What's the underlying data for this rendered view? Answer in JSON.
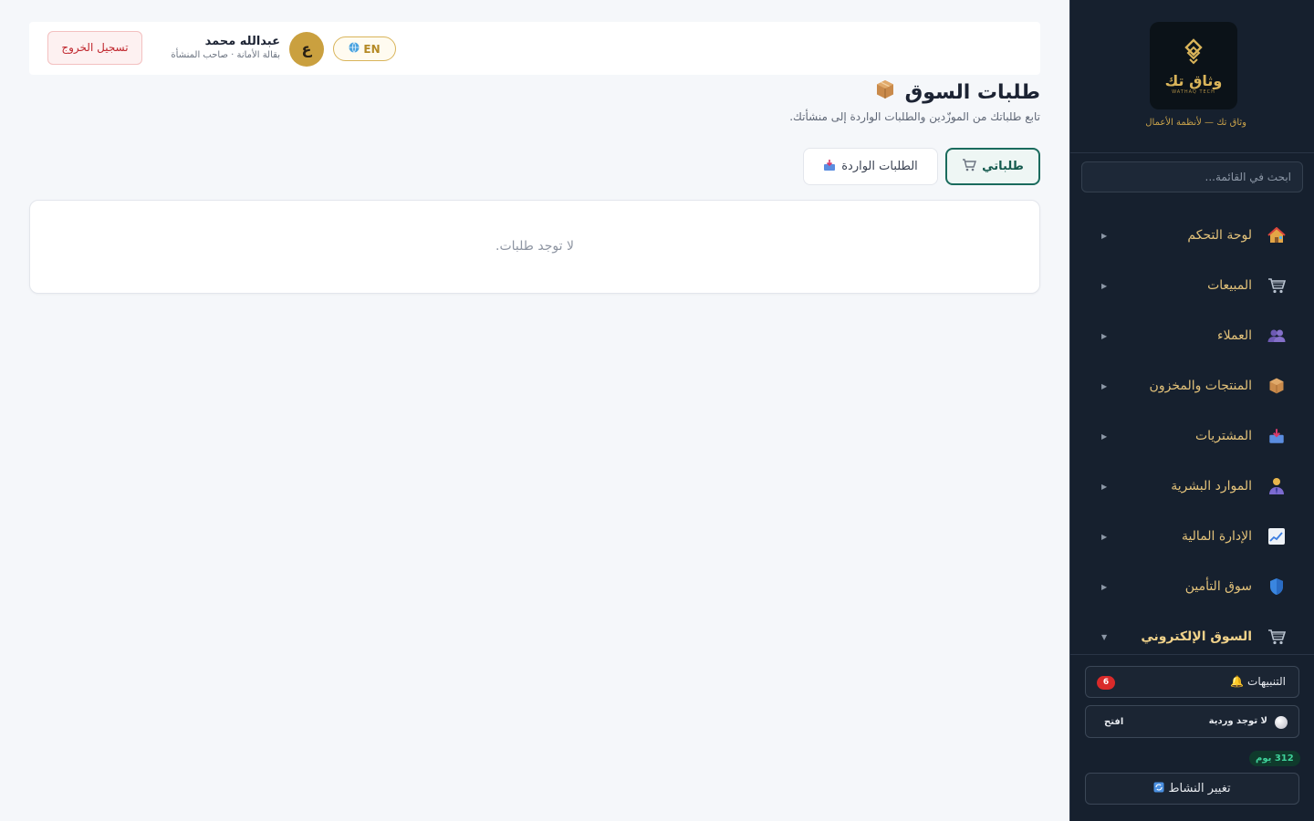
{
  "topbar": {
    "logout_label": "تسجيل الخروج",
    "user_name": "عبدالله محمد",
    "user_meta": "بقالة الأمانة · صاحب المنشأة",
    "avatar_letter": "ع",
    "lang_label": "EN"
  },
  "page": {
    "title": "طلبات السوق",
    "subtitle": "تابع طلباتك من الموزّدين والطلبات الواردة إلى منشأتك."
  },
  "tabs": [
    {
      "label": "طلباتي",
      "icon": "cart-icon",
      "active": true
    },
    {
      "label": "الطلبات الواردة",
      "icon": "inbox-icon",
      "active": false
    }
  ],
  "empty_state": "لا توجد طلبات.",
  "sidebar": {
    "logo_text": "وثاق تك",
    "logo_sub": "WATHAQ TECH",
    "tagline": "وثاق تك — لأنظمة الأعمال",
    "search_placeholder": "ابحث في القائمة...",
    "items": [
      {
        "label": "لوحة التحكم",
        "icon": "home-icon",
        "active": false
      },
      {
        "label": "المبيعات",
        "icon": "cart-icon",
        "active": false
      },
      {
        "label": "العملاء",
        "icon": "users-icon",
        "active": false
      },
      {
        "label": "المنتجات والمخزون",
        "icon": "package-icon",
        "active": false
      },
      {
        "label": "المشتريات",
        "icon": "inbox-icon",
        "active": false
      },
      {
        "label": "الموارد البشرية",
        "icon": "person-icon",
        "active": false
      },
      {
        "label": "الإدارة المالية",
        "icon": "chart-icon",
        "active": false
      },
      {
        "label": "سوق التأمين",
        "icon": "shield-icon",
        "active": false
      },
      {
        "label": "السوق الإلكتروني",
        "icon": "cart-icon",
        "active": true
      }
    ],
    "notifications_label": "التنبيهات",
    "notifications_count": "6",
    "shift_label": "لا توجد وردية",
    "open_label": "افتح",
    "days_label": "312 يوم",
    "change_activity_label": "تغيير النشاط"
  }
}
